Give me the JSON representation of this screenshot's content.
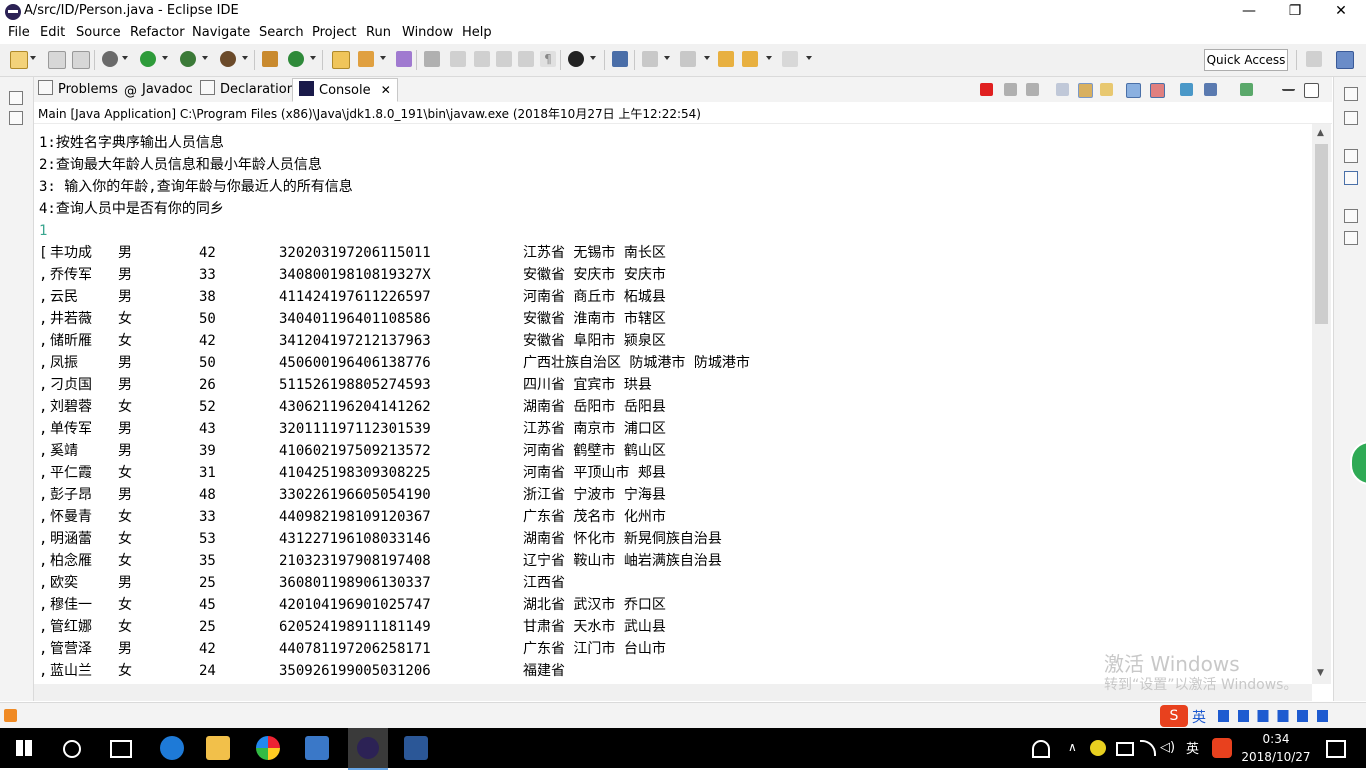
{
  "window": {
    "title": "A/src/ID/Person.java - Eclipse IDE",
    "controls": {
      "minimize": "—",
      "restore": "❐",
      "close": "✕"
    }
  },
  "menu": [
    "File",
    "Edit",
    "Source",
    "Refactor",
    "Navigate",
    "Search",
    "Project",
    "Run",
    "Window",
    "Help"
  ],
  "toolbar": {
    "quick_access": "Quick Access"
  },
  "view_tabs": [
    {
      "label": "Problems",
      "icon": "problems-icon"
    },
    {
      "label": "Javadoc",
      "icon": "javadoc-icon"
    },
    {
      "label": "Declaration",
      "icon": "declaration-icon"
    },
    {
      "label": "Console",
      "icon": "console-icon",
      "active": true
    }
  ],
  "console": {
    "launch": "Main [Java Application] C:\\Program Files (x86)\\Java\\jdk1.8.0_191\\bin\\javaw.exe (2018年10月27日 上午12:22:54)",
    "menu_lines": [
      "1:按姓名字典序输出人员信息",
      "2:查询最大年龄人员信息和最小年龄人员信息",
      "3: 输入你的年龄,查询年龄与你最近人的所有信息",
      "4:查询人员中是否有你的同乡"
    ],
    "user_input": "1",
    "records": [
      {
        "prefix": "[",
        "name": "丰功成",
        "gender": "男",
        "age": "42",
        "id": "320203197206115011",
        "address": "江苏省 无锡市 南长区"
      },
      {
        "prefix": ",",
        "name": "乔传军",
        "gender": "男",
        "age": "33",
        "id": "34080019810819327X",
        "address": "安徽省 安庆市 安庆市"
      },
      {
        "prefix": ",",
        "name": "云民",
        "gender": "男",
        "age": "38",
        "id": "411424197611226597",
        "address": "河南省 商丘市 柘城县"
      },
      {
        "prefix": ",",
        "name": "井若薇",
        "gender": "女",
        "age": "50",
        "id": "340401196401108586",
        "address": "安徽省 淮南市 市辖区"
      },
      {
        "prefix": ",",
        "name": "储昕雁",
        "gender": "女",
        "age": "42",
        "id": "341204197212137963",
        "address": "安徽省 阜阳市 颍泉区"
      },
      {
        "prefix": ",",
        "name": "凤振",
        "gender": "男",
        "age": "50",
        "id": "450600196406138776",
        "address": "广西壮族自治区 防城港市 防城港市"
      },
      {
        "prefix": ",",
        "name": "刁贞国",
        "gender": "男",
        "age": "26",
        "id": "511526198805274593",
        "address": "四川省 宜宾市 珙县"
      },
      {
        "prefix": ",",
        "name": "刘碧蓉",
        "gender": "女",
        "age": "52",
        "id": "430621196204141262",
        "address": "湖南省 岳阳市 岳阳县"
      },
      {
        "prefix": ",",
        "name": "单传军",
        "gender": "男",
        "age": "43",
        "id": "320111197112301539",
        "address": "江苏省 南京市 浦口区"
      },
      {
        "prefix": ",",
        "name": "奚靖",
        "gender": "男",
        "age": "39",
        "id": "410602197509213572",
        "address": "河南省 鹤壁市 鹤山区"
      },
      {
        "prefix": ",",
        "name": "平仁霞",
        "gender": "女",
        "age": "31",
        "id": "410425198309308225",
        "address": "河南省 平顶山市 郏县"
      },
      {
        "prefix": ",",
        "name": "彭子昂",
        "gender": "男",
        "age": "48",
        "id": "330226196605054190",
        "address": "浙江省 宁波市 宁海县"
      },
      {
        "prefix": ",",
        "name": "怀曼青",
        "gender": "女",
        "age": "33",
        "id": "440982198109120367",
        "address": "广东省 茂名市 化州市"
      },
      {
        "prefix": ",",
        "name": "明涵蕾",
        "gender": "女",
        "age": "53",
        "id": "431227196108033146",
        "address": "湖南省 怀化市 新晃侗族自治县"
      },
      {
        "prefix": ",",
        "name": "柏念雁",
        "gender": "女",
        "age": "35",
        "id": "210323197908197408",
        "address": "辽宁省 鞍山市 岫岩满族自治县"
      },
      {
        "prefix": ",",
        "name": "欧奕",
        "gender": "男",
        "age": "25",
        "id": "360801198906130337",
        "address": "江西省"
      },
      {
        "prefix": ",",
        "name": "穆佳一",
        "gender": "女",
        "age": "45",
        "id": "420104196901025747",
        "address": "湖北省 武汉市 乔口区"
      },
      {
        "prefix": ",",
        "name": "管红娜",
        "gender": "女",
        "age": "25",
        "id": "620524198911181149",
        "address": "甘肃省 天水市 武山县"
      },
      {
        "prefix": ",",
        "name": "管营泽",
        "gender": "男",
        "age": "42",
        "id": "440781197206258171",
        "address": "广东省 江门市 台山市"
      },
      {
        "prefix": ",",
        "name": "蓝山兰",
        "gender": "女",
        "age": "24",
        "id": "350926199005031206",
        "address": "福建省"
      }
    ]
  },
  "watermark": {
    "line1": "激活 Windows",
    "line2": "转到“设置”以激活 Windows。"
  },
  "taskbar": {
    "ime": "英",
    "time": "0:34",
    "date": "2018/10/27"
  },
  "colors": {
    "input_text": "#3aa68f",
    "accent": "#0078d7",
    "terminate_red": "#e02020"
  }
}
